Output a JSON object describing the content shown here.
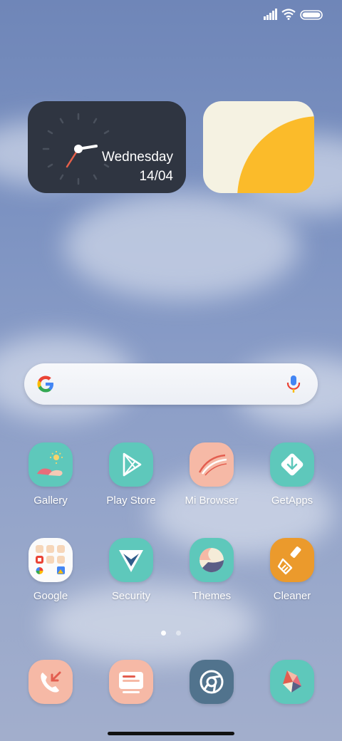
{
  "status_bar": {
    "signal_icon": "signal-icon",
    "wifi_icon": "wifi-icon",
    "battery_icon": "battery-icon"
  },
  "clock_widget": {
    "day": "Wednesday",
    "date": "14/04",
    "time_display": "analog"
  },
  "search_bar": {
    "logo_icon": "google-g-icon",
    "mic_icon": "microphone-icon"
  },
  "apps_row1": [
    {
      "label": "Gallery",
      "icon": "gallery-icon"
    },
    {
      "label": "Play Store",
      "icon": "play-store-icon"
    },
    {
      "label": "Mi Browser",
      "icon": "mi-browser-icon"
    },
    {
      "label": "GetApps",
      "icon": "getapps-icon"
    }
  ],
  "apps_row2": [
    {
      "label": "Google",
      "icon": "google-folder-icon"
    },
    {
      "label": "Security",
      "icon": "security-icon"
    },
    {
      "label": "Themes",
      "icon": "themes-icon"
    },
    {
      "label": "Cleaner",
      "icon": "cleaner-icon"
    }
  ],
  "page_indicator": {
    "pages": 2,
    "current": 1
  },
  "dock": [
    {
      "icon": "phone-icon"
    },
    {
      "icon": "messages-icon"
    },
    {
      "icon": "chrome-icon"
    },
    {
      "icon": "gallery-app-icon"
    }
  ],
  "colors": {
    "teal": "#5ec8bb",
    "peach": "#f6b9a6",
    "orange": "#eb9a2c",
    "dark": "#2f3541",
    "yellow": "#fbbb2a"
  }
}
